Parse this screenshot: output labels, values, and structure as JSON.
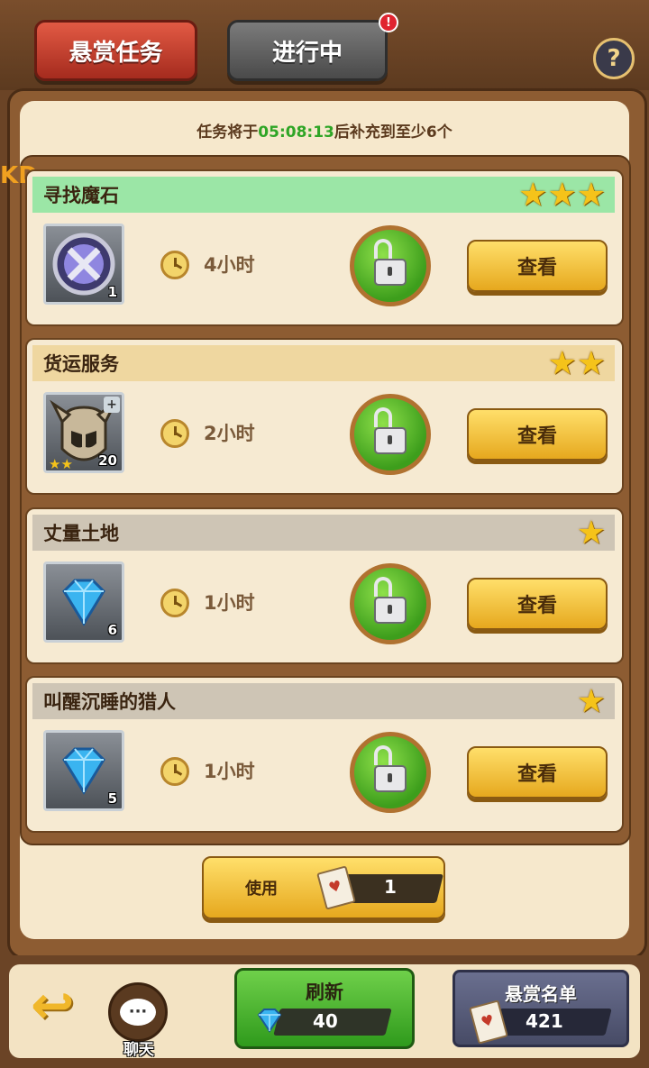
{
  "tabs": {
    "bounty": "悬赏任务",
    "in_progress": "进行中",
    "badge": "!",
    "help": "?"
  },
  "notice": {
    "prefix": "任务将于",
    "time": "05:08:13",
    "suffix": "后补充到至少6个"
  },
  "edge_text": "KD",
  "tasks": [
    {
      "title": "寻找魔石",
      "stars": 3,
      "title_bg": "#9be6a6",
      "item_icon": "magic-stone-icon",
      "item_count": "1",
      "duration": "4小时",
      "view_label": "查看"
    },
    {
      "title": "货运服务",
      "stars": 2,
      "title_bg": "#efd7a0",
      "item_icon": "helmet-icon",
      "item_count": "20",
      "item_stars": "★★",
      "duration": "2小时",
      "view_label": "查看"
    },
    {
      "title": "丈量土地",
      "stars": 1,
      "title_bg": "#cec5b5",
      "item_icon": "diamond-icon",
      "item_count": "6",
      "duration": "1小时",
      "view_label": "查看"
    },
    {
      "title": "叫醒沉睡的猎人",
      "stars": 1,
      "title_bg": "#cec5b5",
      "item_icon": "diamond-icon",
      "item_count": "5",
      "duration": "1小时",
      "view_label": "查看"
    }
  ],
  "use_button": {
    "label": "使用",
    "count": "1"
  },
  "bottom": {
    "chat_label": "聊天",
    "refresh_label": "刷新",
    "refresh_cost": "40",
    "bounty_list_label": "悬赏名单",
    "bounty_list_count": "421"
  },
  "colors": {
    "accent_green": "#2fa526",
    "tab_red": "#c9412f",
    "button_gold": "#f2c24a"
  }
}
